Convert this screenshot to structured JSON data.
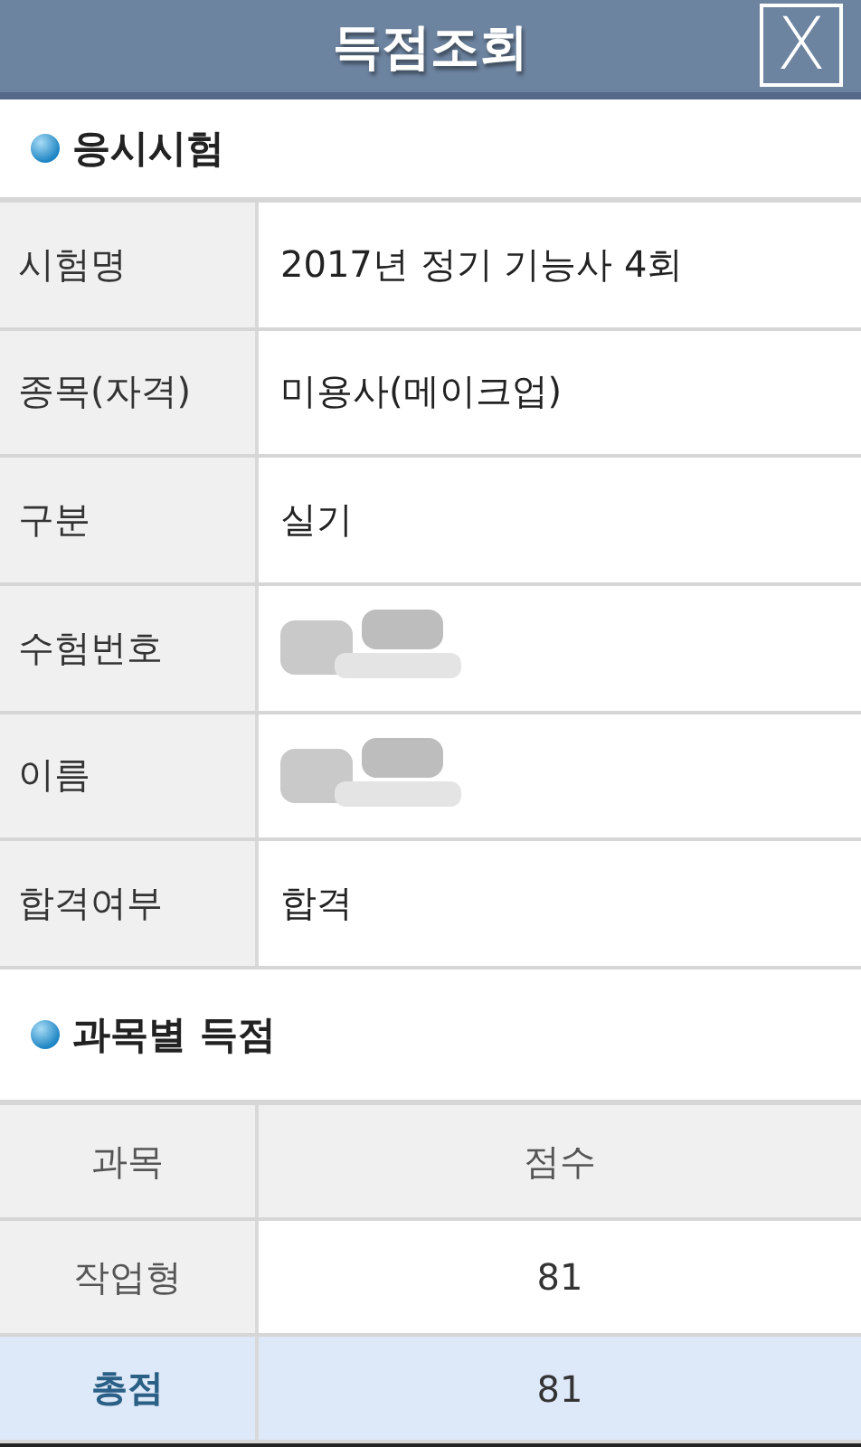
{
  "header": {
    "title": "득점조회",
    "close": "X"
  },
  "exam_section": {
    "heading": "응시시험",
    "rows": [
      {
        "label": "시험명",
        "value": "2017년 정기 기능사 4회",
        "redacted": false
      },
      {
        "label": "종목(자격)",
        "value": "미용사(메이크업)",
        "redacted": false
      },
      {
        "label": "구분",
        "value": "실기",
        "redacted": false
      },
      {
        "label": "수험번호",
        "redacted": true
      },
      {
        "label": "이름",
        "redacted": true
      },
      {
        "label": "합격여부",
        "value": "합격",
        "redacted": false
      }
    ]
  },
  "score_section": {
    "heading": "과목별 득점",
    "columns": [
      "과목",
      "점수"
    ],
    "rows": [
      {
        "kind": "subject",
        "subject": "작업형",
        "score": "81"
      },
      {
        "kind": "total",
        "subject": "총점",
        "score": "81"
      }
    ]
  }
}
